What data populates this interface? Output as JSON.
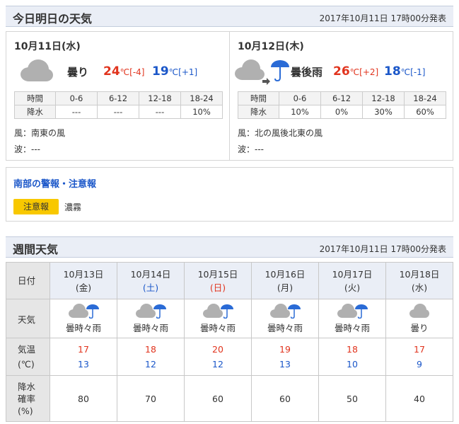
{
  "today_section": {
    "title": "今日明日の天気",
    "issued": "2017年10月11日 17時00分発表"
  },
  "days": [
    {
      "date": "10月11日(水)",
      "icon": "cloudy-icon",
      "condition": "曇り",
      "high": "24",
      "high_diff": "[-4]",
      "low": "19",
      "low_diff": "[+1]",
      "unit": "℃",
      "rain_header": [
        "時間",
        "0-6",
        "6-12",
        "12-18",
        "18-24"
      ],
      "rain_values": [
        "降水",
        "---",
        "---",
        "---",
        "10%"
      ],
      "wind": "風：南東の風",
      "wave": "波：---"
    },
    {
      "date": "10月12日(木)",
      "icon": "cloudy-then-rain-icon",
      "condition": "曇後雨",
      "high": "26",
      "high_diff": "[+2]",
      "low": "18",
      "low_diff": "[-1]",
      "unit": "℃",
      "rain_header": [
        "時間",
        "0-6",
        "6-12",
        "12-18",
        "18-24"
      ],
      "rain_values": [
        "降水",
        "10%",
        "0%",
        "30%",
        "60%"
      ],
      "wind": "風：北の風後北東の風",
      "wave": "波：---"
    }
  ],
  "warnings": {
    "title": "南部の警報・注意報",
    "badge": "注意報",
    "text": "濃霧"
  },
  "weekly_section": {
    "title": "週間天気",
    "issued": "2017年10月11日 17時00分発表"
  },
  "weekly": {
    "row_labels": {
      "date": "日付",
      "weather": "天気",
      "temp_line1": "気温",
      "temp_line2": "(℃)",
      "pop_line1": "降水",
      "pop_line2": "確率",
      "pop_line3": "(%)"
    },
    "days": [
      {
        "date": "10月13日",
        "dow": "(金)",
        "dow_type": "weekday",
        "icon": "cloudy-sometimes-rain-icon",
        "weather": "曇時々雨",
        "high": "17",
        "low": "13",
        "pop": "80"
      },
      {
        "date": "10月14日",
        "dow": "(土)",
        "dow_type": "saturday",
        "icon": "cloudy-sometimes-rain-icon",
        "weather": "曇時々雨",
        "high": "18",
        "low": "12",
        "pop": "70"
      },
      {
        "date": "10月15日",
        "dow": "(日)",
        "dow_type": "sunday",
        "icon": "cloudy-sometimes-rain-icon",
        "weather": "曇時々雨",
        "high": "20",
        "low": "12",
        "pop": "60"
      },
      {
        "date": "10月16日",
        "dow": "(月)",
        "dow_type": "weekday",
        "icon": "cloudy-sometimes-rain-icon",
        "weather": "曇時々雨",
        "high": "19",
        "low": "13",
        "pop": "60"
      },
      {
        "date": "10月17日",
        "dow": "(火)",
        "dow_type": "weekday",
        "icon": "cloudy-sometimes-rain-icon",
        "weather": "曇時々雨",
        "high": "18",
        "low": "10",
        "pop": "50"
      },
      {
        "date": "10月18日",
        "dow": "(水)",
        "dow_type": "weekday",
        "icon": "cloudy-icon",
        "weather": "曇り",
        "high": "17",
        "low": "9",
        "pop": "40"
      }
    ]
  },
  "colors": {
    "header_bg": "#eaeef6",
    "high_temp": "#e1341e",
    "low_temp": "#1b57c9",
    "warning_badge": "#f8c800"
  }
}
